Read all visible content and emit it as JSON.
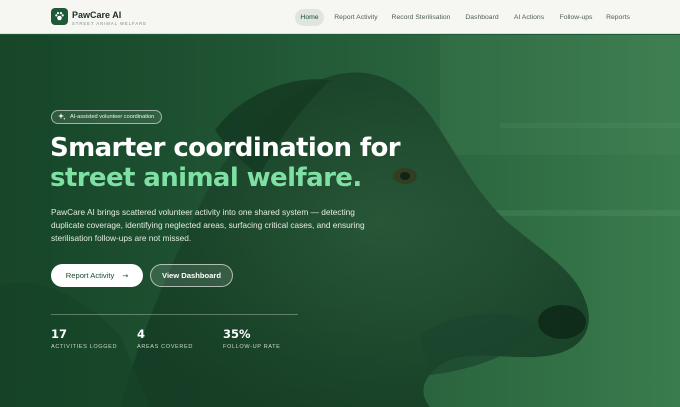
{
  "brand": {
    "name": "PawCare AI",
    "tagline": "STREET ANIMAL WELFARE",
    "logo_icon": "paw-icon"
  },
  "nav": {
    "items": [
      {
        "label": "Home",
        "active": true
      },
      {
        "label": "Report Activity",
        "active": false
      },
      {
        "label": "Record Sterilisation",
        "active": false
      },
      {
        "label": "Dashboard",
        "active": false
      },
      {
        "label": "AI Actions",
        "active": false
      },
      {
        "label": "Follow-ups",
        "active": false
      },
      {
        "label": "Reports",
        "active": false
      }
    ]
  },
  "hero": {
    "badge_label": "AI-assisted volunteer coordination",
    "badge_icon": "sparkle-icon",
    "headline_line1": "Smarter coordination for",
    "headline_line2": "street animal welfare.",
    "description": "PawCare AI brings scattered volunteer activity into one shared system — detecting duplicate coverage, identifying neglected areas, surfacing critical cases, and ensuring sterilisation follow-ups are not missed.",
    "primary_button": "Report Activity",
    "primary_button_icon": "arrow-right-icon",
    "secondary_button": "View Dashboard",
    "background_image": "dog-photo"
  },
  "stats": [
    {
      "value": "17",
      "label": "ACTIVITIES LOGGED"
    },
    {
      "value": "4",
      "label": "AREAS COVERED"
    },
    {
      "value": "35%",
      "label": "FOLLOW-UP RATE"
    }
  ],
  "colors": {
    "brand_green": "#1e5a38",
    "accent_green": "#7ee0a3",
    "hero_overlay": "#255c39"
  }
}
